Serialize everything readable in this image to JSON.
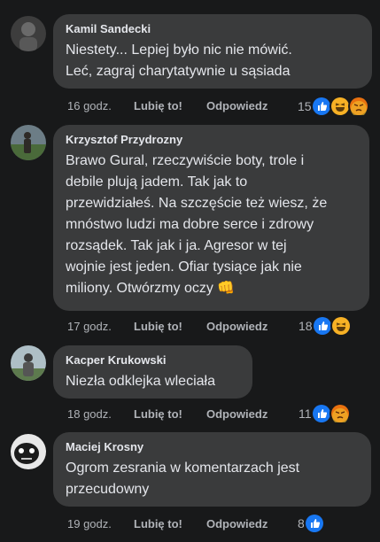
{
  "comments": [
    {
      "author": "Kamil Sandecki",
      "text": "Niestety... Lepiej było nic nie mówić.\nLeć, zagraj charytatywnie u sąsiada",
      "time": "16 godz.",
      "like_label": "Lubię to!",
      "reply_label": "Odpowiedz",
      "reaction_count": "15",
      "reactions": [
        "like-icon",
        "haha-icon",
        "angry-icon"
      ]
    },
    {
      "author": "Krzysztof Przydrozny",
      "text": "Brawo Gural, rzeczywiście boty, trole i\ndebile plują jadem. Tak jak to\nprzewidziałeś. Na szczęście też wiesz, że\nmnóstwo ludzi ma dobre serce i zdrowy\nrozsądek. Tak jak i ja. Agresor w tej\nwojnie jest jeden. Ofiar tysiące jak nie\nmiliony. Otwórzmy oczy",
      "emoji": "👊",
      "time": "17 godz.",
      "like_label": "Lubię to!",
      "reply_label": "Odpowiedz",
      "reaction_count": "18",
      "reactions": [
        "like-icon",
        "haha-icon"
      ]
    },
    {
      "author": "Kacper Krukowski",
      "text": "Niezła odklejka wleciała",
      "time": "18 godz.",
      "like_label": "Lubię to!",
      "reply_label": "Odpowiedz",
      "reaction_count": "11",
      "reactions": [
        "like-icon",
        "angry-icon"
      ]
    },
    {
      "author": "Maciej Krosny",
      "text": "Ogrom zesrania w komentarzach jest\nprzecudowny",
      "time": "19 godz.",
      "like_label": "Lubię to!",
      "reply_label": "Odpowiedz",
      "reaction_count": "8",
      "reactions": [
        "like-icon"
      ]
    }
  ],
  "colors": {
    "background": "#18191a",
    "bubble": "#3a3b3c",
    "secondary_text": "#b0b3b8",
    "like_blue": "#1877f2"
  }
}
